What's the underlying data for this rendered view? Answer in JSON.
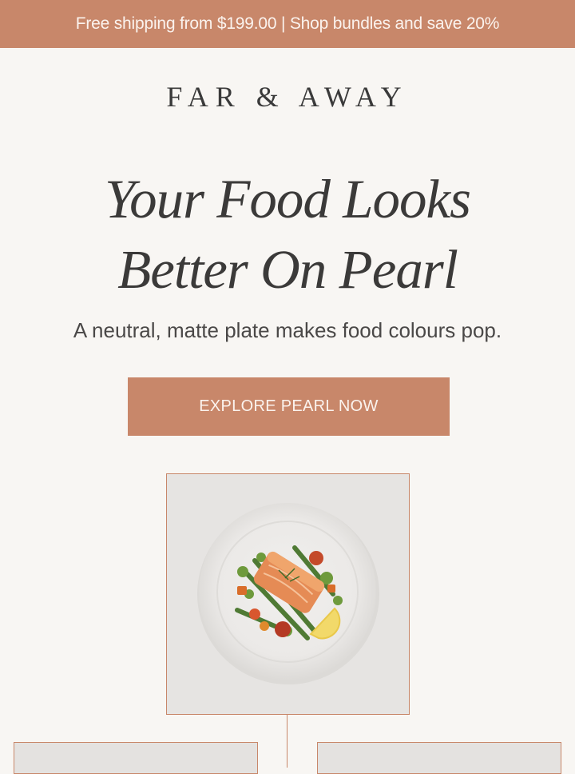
{
  "announcement": {
    "text": "Free shipping from $199.00 | Shop bundles and save 20%"
  },
  "brand": {
    "name": "FAR & AWAY"
  },
  "hero": {
    "headline_line1": "Your Food Looks",
    "headline_line2": "Better On Pearl",
    "subheadline": "A neutral, matte plate makes food colours pop.",
    "cta_label": "EXPLORE PEARL NOW"
  },
  "images": [
    {
      "name": "pearl-plate-salmon"
    },
    {
      "name": "product-thumbnail-left"
    },
    {
      "name": "product-thumbnail-right"
    }
  ],
  "colors": {
    "accent": "#c8876a",
    "background": "#f8f6f3",
    "text": "#3b3a3a"
  }
}
